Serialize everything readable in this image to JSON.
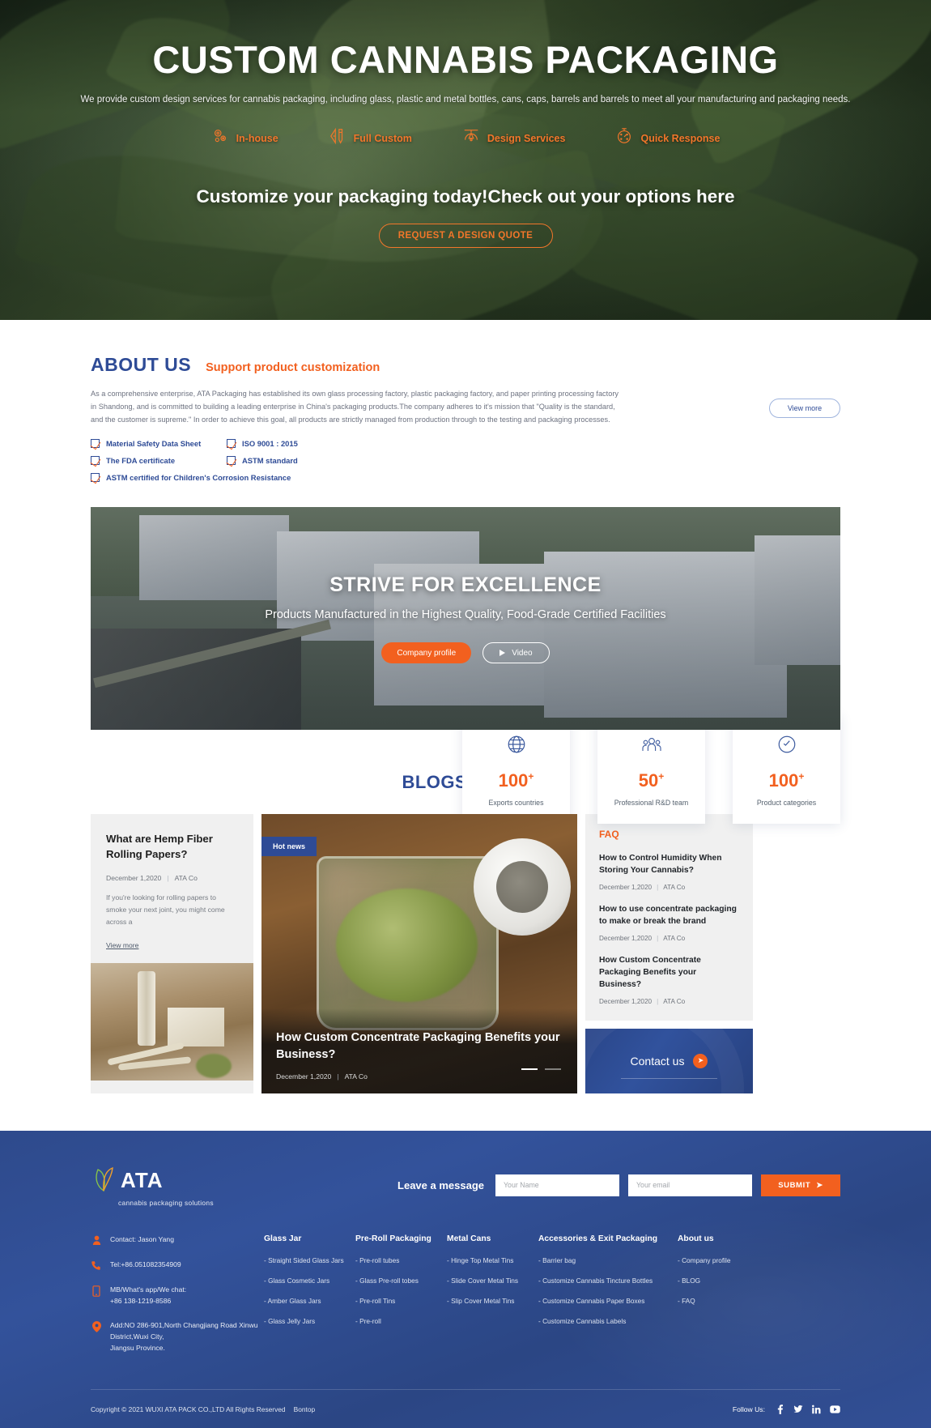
{
  "hero": {
    "title": "CUSTOM CANNABIS PACKAGING",
    "subtitle": "We provide custom design services for cannabis packaging, including glass, plastic and metal bottles, cans, caps, barrels and barrels to meet all your manufacturing and packaging needs.",
    "features": [
      {
        "label": "In-house",
        "icon": "gears-icon"
      },
      {
        "label": "Full Custom",
        "icon": "pencil-ruler-icon"
      },
      {
        "label": "Design Services",
        "icon": "pen-nib-icon"
      },
      {
        "label": "Quick Response",
        "icon": "stopwatch-icon"
      }
    ],
    "cta_line": "Customize your packaging today!Check out your options here",
    "cta_button": "REQUEST A DESIGN QUOTE"
  },
  "about": {
    "title": "ABOUT US",
    "tagline": "Support product customization",
    "paragraph": "As a comprehensive enterprise, ATA Packaging has established its own glass processing factory, plastic packaging factory, and paper printing processing factory in Shandong, and is committed to building a leading enterprise in China's packaging products.The company adheres to it's mission that \"Quality is the standard, and the customer is supreme.\"  In order to achieve this goal, all products are strictly managed from production through to the testing and packaging processes.",
    "view_more": "View more",
    "certs": [
      "Material Safety Data Sheet",
      "ISO 9001 : 2015",
      "The FDA certificate",
      "ASTM standard",
      "ASTM certified for Children's Corrosion Resistance"
    ],
    "stats": [
      {
        "icon": "globe-icon",
        "number": "100",
        "plus": "+",
        "label": "Exports countries"
      },
      {
        "icon": "team-icon",
        "number": "50",
        "plus": "+",
        "label": "Professional R&D team"
      },
      {
        "icon": "tag-icon",
        "number": "100",
        "plus": "+",
        "label": "Product categories"
      }
    ]
  },
  "factory": {
    "title": "STRIVE FOR EXCELLENCE",
    "subtitle": "Products Manufactured in the Highest Quality, Food-Grade Certified Facilities",
    "profile_button": "Company profile",
    "video_button": "Video"
  },
  "blogs": {
    "section_title": "BLOGS & FAQ",
    "left": {
      "title": "What are Hemp Fiber Rolling Papers?",
      "date": "December 1,2020",
      "author": "ATA Co",
      "excerpt": "If you're looking for rolling papers to smoke your next joint, you might come across a",
      "view_more": "View more"
    },
    "featured": {
      "badge": "Hot news",
      "title": "How Custom Concentrate Packaging Benefits your Business?",
      "date": "December 1,2020",
      "author": "ATA Co"
    },
    "faq": {
      "kicker": "FAQ",
      "items": [
        {
          "question": "How to Control Humidity When Storing Your Cannabis?",
          "date": "December 1,2020",
          "author": "ATA Co"
        },
        {
          "question": "How to use concentrate packaging to make or break the brand",
          "date": "December 1,2020",
          "author": "ATA Co"
        },
        {
          "question": "How Custom Concentrate Packaging Benefits your Business?",
          "date": "December 1,2020",
          "author": "ATA Co"
        }
      ]
    },
    "contact_cta": "Contact us"
  },
  "footer": {
    "logo_text": "ATA",
    "logo_sub": "cannabis  packaging solutions",
    "message_label": "Leave a message",
    "name_placeholder": "Your Name",
    "email_placeholder": "Your email",
    "submit_label": "SUBMIT",
    "contact": [
      {
        "icon": "user-icon",
        "text": "Contact: Jason Yang"
      },
      {
        "icon": "phone-icon",
        "text": "Tel:+86.051082354909"
      },
      {
        "icon": "mobile-icon",
        "text": "MB/What's app/We chat:\n+86 138-1219-8586"
      },
      {
        "icon": "location-icon",
        "text": "Add:NO 286-901,North Changjiang Road Xinwu District,Wuxi City,\nJiangsu Province."
      }
    ],
    "columns": [
      {
        "head": "Glass Jar",
        "links": [
          "- Straight Sided Glass Jars",
          "- Glass Cosmetic Jars",
          "- Amber Glass Jars",
          "- Glass Jelly Jars"
        ]
      },
      {
        "head": "Pre-Roll Packaging",
        "links": [
          "- Pre-roll tubes",
          "- Glass Pre-roll tobes",
          "- Pre-roll Tins",
          "- Pre-roll"
        ]
      },
      {
        "head": "Metal Cans",
        "links": [
          "- Hinge Top Metal Tins",
          "- Slide Cover Metal Tins",
          "- Slip Cover Metal Tins"
        ]
      },
      {
        "head": "Accessories & Exit Packaging",
        "links": [
          "- Barrier bag",
          "- Customize Cannabis Tincture Bottles",
          "- Customize Cannabis Paper Boxes",
          "- Customize Cannabis Labels"
        ]
      },
      {
        "head": "About us",
        "links": [
          "- Company profile",
          "- BLOG",
          "- FAQ"
        ]
      }
    ],
    "copyright": "Copyright © 2021 WUXI ATA PACK CO.,LTD All Rights Reserved",
    "copyright_extra": "Bontop",
    "follow_label": "Follow Us:",
    "social": [
      "facebook-icon",
      "twitter-icon",
      "linkedin-icon",
      "youtube-icon"
    ]
  },
  "colors": {
    "brand_blue": "#2e4b96",
    "accent_orange": "#f2601f",
    "hero_orange": "#f2762a"
  }
}
